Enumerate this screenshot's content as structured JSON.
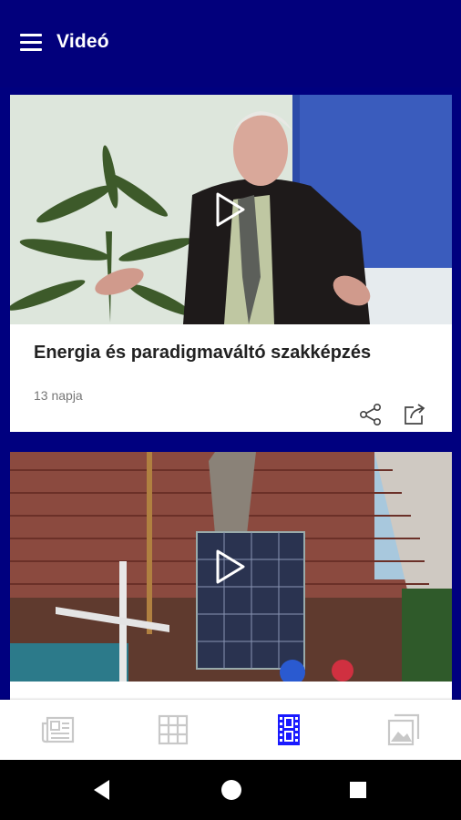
{
  "app_bar": {
    "title": "Videó",
    "menu_icon": "hamburger-menu-icon"
  },
  "videos": [
    {
      "title": "Energia és paradigmaváltó szakképzés",
      "time": "13 napja",
      "play_icon": "play-icon",
      "share_icon": "share-icon",
      "export_icon": "open-external-icon"
    },
    {
      "title": "",
      "time": "",
      "play_icon": "play-icon"
    }
  ],
  "bottom_nav": {
    "items": [
      {
        "icon": "news-icon",
        "active": false
      },
      {
        "icon": "grid-icon",
        "active": false
      },
      {
        "icon": "video-film-icon",
        "active": true
      },
      {
        "icon": "gallery-icon",
        "active": false
      }
    ],
    "active_color": "#1a1aff",
    "inactive_color": "#c8c8c8"
  },
  "system_nav": {
    "back_icon": "back-triangle-icon",
    "home_icon": "home-circle-icon",
    "recents_icon": "recents-square-icon"
  },
  "colors": {
    "app_bar": "#02007c",
    "background": "#00007f",
    "card": "#ffffff",
    "title_text": "#222222",
    "meta_text": "#777777"
  }
}
